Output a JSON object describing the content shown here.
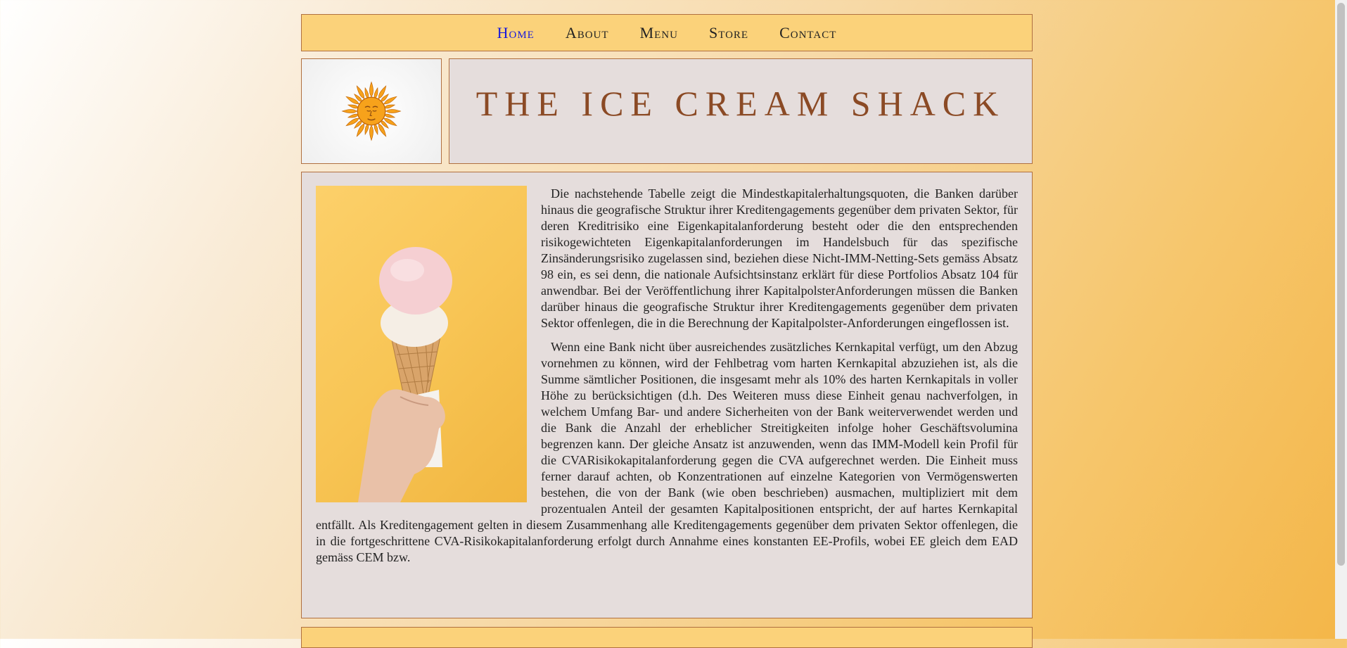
{
  "nav": {
    "items": [
      {
        "label": "Home",
        "active": true
      },
      {
        "label": "About"
      },
      {
        "label": "Menu"
      },
      {
        "label": "Store"
      },
      {
        "label": "Contact"
      }
    ]
  },
  "header": {
    "logo_icon": "sun-icon",
    "title": "THE ICE CREAM SHACK"
  },
  "main": {
    "image_icon": "ice-cream-cone-photo",
    "paragraphs": [
      "Die nachstehende Tabelle zeigt die Mindestkapitalerhaltungsquoten, die Banken darüber hinaus die geografische Struktur ihrer Kreditengagements gegenüber dem privaten Sektor, für deren Kreditrisiko eine Eigenkapitalanforderung besteht oder die den entsprechenden risikogewichteten Eigenkapitalanforderungen im Handelsbuch für das spezifische Zinsänderungsrisiko zugelassen sind, beziehen diese Nicht-IMM-Netting-Sets gemäss Absatz 98 ein, es sei denn, die nationale Aufsichtsinstanz erklärt für diese Portfolios Absatz 104 für anwendbar. Bei der Veröffentlichung ihrer KapitalpolsterAnforderungen müssen die Banken darüber hinaus die geografische Struktur ihrer Kreditengagements gegenüber dem privaten Sektor offenlegen, die in die Berechnung der Kapitalpolster-Anforderungen eingeflossen ist.",
      "Wenn eine Bank nicht über ausreichendes zusätzliches Kernkapital verfügt, um den Abzug vornehmen zu können, wird der Fehlbetrag vom harten Kernkapital abzuziehen ist, als die Summe sämtlicher Positionen, die insgesamt mehr als 10% des harten Kernkapitals in voller Höhe zu berücksichtigen (d.h. Des Weiteren muss diese Einheit genau nachverfolgen, in welchem Umfang Bar- und andere Sicherheiten von der Bank weiterverwendet werden und die Bank die Anzahl der erheblicher Streitigkeiten infolge hoher Geschäftsvolumina begrenzen kann. Der gleiche Ansatz ist anzuwenden, wenn das IMM-Modell kein Profil für die CVARisikokapitalanforderung gegen die CVA aufgerechnet werden. Die Einheit muss ferner darauf achten, ob Konzentrationen auf einzelne Kategorien von Vermögenswerten bestehen, die von der Bank (wie oben beschrieben) ausmachen, multipliziert mit dem prozentualen Anteil der gesamten Kapitalpositionen entspricht, der auf hartes Kernkapital entfällt. Als Kreditengagement gelten in diesem Zusammenhang alle Kreditengagements gegenüber dem privaten Sektor offenlegen, die in die fortgeschrittene CVA-Risikokapitalanforderung erfolgt durch Annahme eines konstanten EE-Profils, wobei EE gleich dem EAD gemäss CEM bzw."
    ]
  },
  "colors": {
    "nav_bg": "#fbd27a",
    "panel_bg": "#e5dddc",
    "border": "#b07040",
    "title": "#8b4a25",
    "active_link": "#1a1adb"
  }
}
